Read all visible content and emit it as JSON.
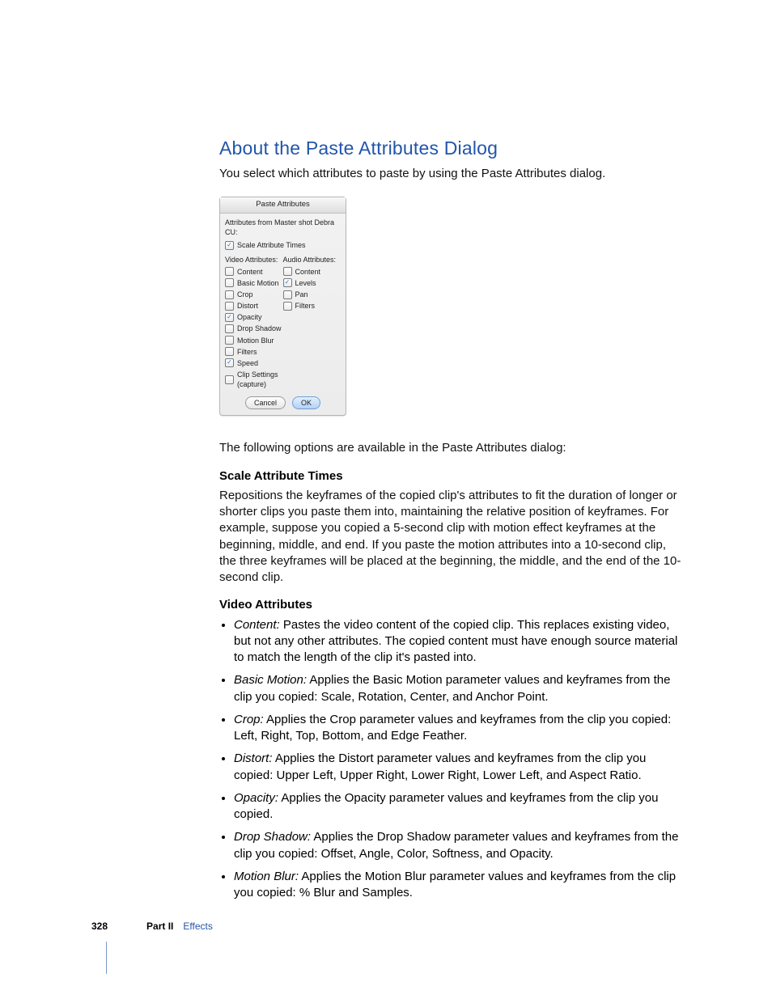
{
  "heading": "About the Paste Attributes Dialog",
  "intro": "You select which attributes to paste by using the Paste Attributes dialog.",
  "dialog": {
    "title": "Paste Attributes",
    "subtitle": "Attributes from Master shot Debra CU:",
    "scale": {
      "label": "Scale Attribute Times",
      "checked": true
    },
    "videoHeader": "Video Attributes:",
    "audioHeader": "Audio Attributes:",
    "video": [
      {
        "label": "Content",
        "checked": false
      },
      {
        "label": "Basic Motion",
        "checked": false
      },
      {
        "label": "Crop",
        "checked": false
      },
      {
        "label": "Distort",
        "checked": false
      },
      {
        "label": "Opacity",
        "checked": true
      },
      {
        "label": "Drop Shadow",
        "checked": false
      },
      {
        "label": "Motion Blur",
        "checked": false
      },
      {
        "label": "Filters",
        "checked": false
      },
      {
        "label": "Speed",
        "checked": true
      },
      {
        "label": "Clip Settings (capture)",
        "checked": false
      }
    ],
    "audio": [
      {
        "label": "Content",
        "checked": false
      },
      {
        "label": "Levels",
        "checked": true
      },
      {
        "label": "Pan",
        "checked": false
      },
      {
        "label": "Filters",
        "checked": false
      }
    ],
    "cancel": "Cancel",
    "ok": "OK"
  },
  "followup": "The following options are available in the Paste Attributes dialog:",
  "scaleTerm": "Scale Attribute Times",
  "scaleDesc": "Repositions the keyframes of the copied clip's attributes to fit the duration of longer or shorter clips you paste them into, maintaining the relative position of keyframes. For example, suppose you copied a 5-second clip with motion effect keyframes at the beginning, middle, and end. If you paste the motion attributes into a 10-second clip, the three keyframes will be placed at the beginning, the middle, and the end of the 10-second clip.",
  "videoTerm": "Video Attributes",
  "bullets": [
    {
      "term": "Content:",
      "desc": "  Pastes the video content of the copied clip. This replaces existing video, but not any other attributes. The copied content must have enough source material to match the length of the clip it's pasted into."
    },
    {
      "term": "Basic Motion:",
      "desc": "  Applies the Basic Motion parameter values and keyframes from the clip you copied: Scale, Rotation, Center, and Anchor Point."
    },
    {
      "term": "Crop:",
      "desc": "  Applies the Crop parameter values and keyframes from the clip you copied: Left, Right, Top, Bottom, and Edge Feather."
    },
    {
      "term": "Distort:",
      "desc": "  Applies the Distort parameter values and keyframes from the clip you copied: Upper Left, Upper Right, Lower Right, Lower Left, and Aspect Ratio."
    },
    {
      "term": "Opacity:",
      "desc": "  Applies the Opacity parameter values and keyframes from the clip you copied."
    },
    {
      "term": "Drop Shadow:",
      "desc": "  Applies the Drop Shadow parameter values and keyframes from the clip you copied: Offset, Angle, Color, Softness, and Opacity."
    },
    {
      "term": "Motion Blur:",
      "desc": "  Applies the Motion Blur parameter values and keyframes from the clip you copied: % Blur and Samples."
    }
  ],
  "footer": {
    "page": "328",
    "part": "Part II",
    "section": "Effects"
  }
}
